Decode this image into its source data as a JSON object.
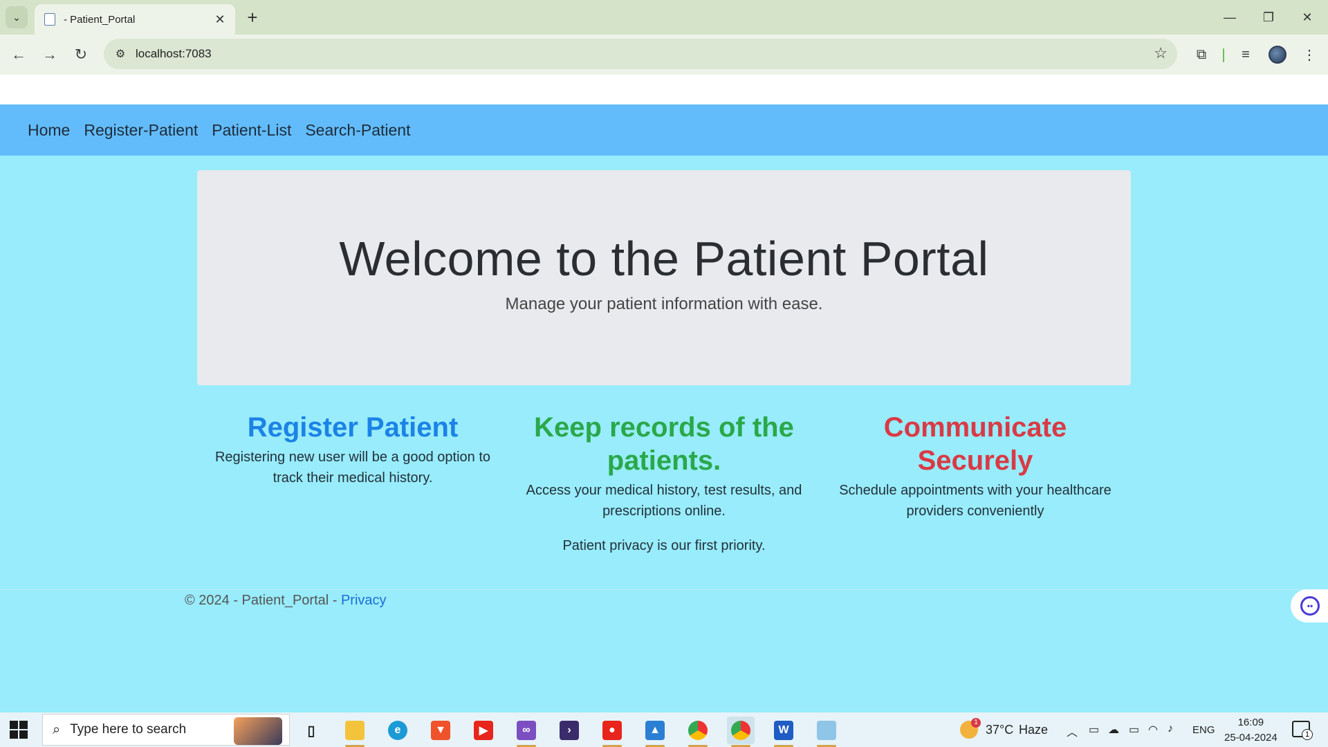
{
  "browser": {
    "tab_title": "- Patient_Portal",
    "url": "localhost:7083",
    "new_tab": "+",
    "tab_close": "✕",
    "minimize": "—",
    "restore": "❐",
    "close": "✕"
  },
  "navbar": {
    "items": [
      "Home",
      "Register-Patient",
      "Patient-List",
      "Search-Patient"
    ]
  },
  "jumbotron": {
    "title": "Welcome to the Patient Portal",
    "subtitle": "Manage your patient information with ease."
  },
  "features": [
    {
      "title": "Register Patient",
      "text": "Registering new user will be a good option to track their medical history.",
      "color": "#1b82e6"
    },
    {
      "title": "Keep records of the patients.",
      "text": "Access your medical history, test results, and prescriptions online.",
      "extra": "Patient privacy is our first priority.",
      "color": "#2aa84a"
    },
    {
      "title": "Communicate Securely",
      "text": "Schedule appointments with your healthcare providers conveniently",
      "color": "#d93a45"
    }
  ],
  "footer": {
    "copyright": "© 2024 - Patient_Portal - ",
    "privacy_link": "Privacy"
  },
  "taskbar": {
    "search_placeholder": "Type here to search",
    "weather_temp": "37°C",
    "weather_desc": "Haze",
    "weather_badge": "1",
    "language": "ENG",
    "time": "16:09",
    "date": "25-04-2024",
    "notification_count": "1",
    "apps": [
      "task-view-icon",
      "file-explorer-icon",
      "edge-icon",
      "brave-icon",
      "youtube-icon",
      "visual-studio-icon",
      "terminal-icon",
      "media-app-icon",
      "photos-icon",
      "chrome-icon",
      "chrome-active-icon",
      "word-icon",
      "notepad-icon"
    ]
  }
}
